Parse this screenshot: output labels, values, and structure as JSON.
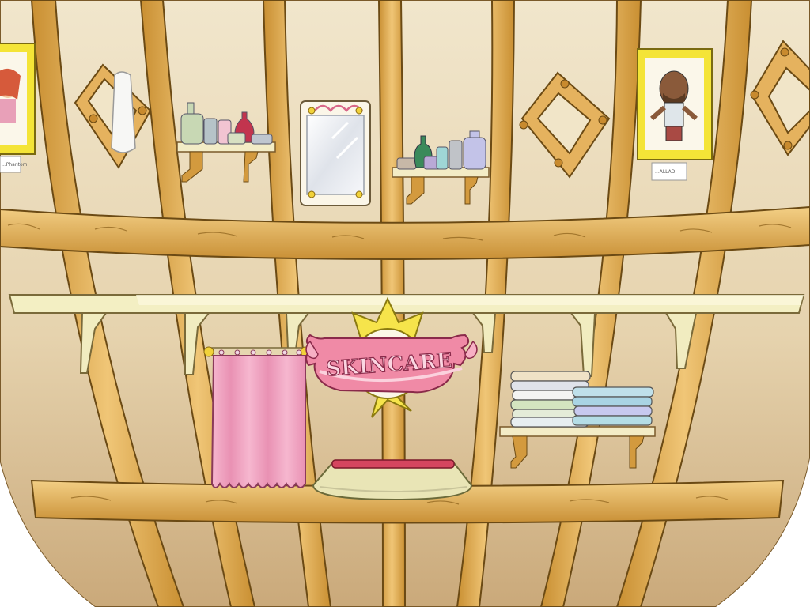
{
  "scene": {
    "name": "skincare-shop-room",
    "sign_text": "SKINCARE",
    "plaque_left_text": "...Phantom",
    "plaque_right_text": "...ALLAD",
    "colors": {
      "wall": "#efe2c4",
      "wall_shadow": "#c9b48c",
      "wood": "#e3b866",
      "wood_dark": "#a9761f",
      "wood_line": "#6b4a14",
      "shelf": "#f3efc9",
      "curtain": "#f2a9c4",
      "sign_ribbon": "#ef7a96",
      "sun": "#f6e34a",
      "frame": "#f3e43a",
      "counter": "#e9e6b5",
      "counter_top": "#d64b68"
    }
  }
}
